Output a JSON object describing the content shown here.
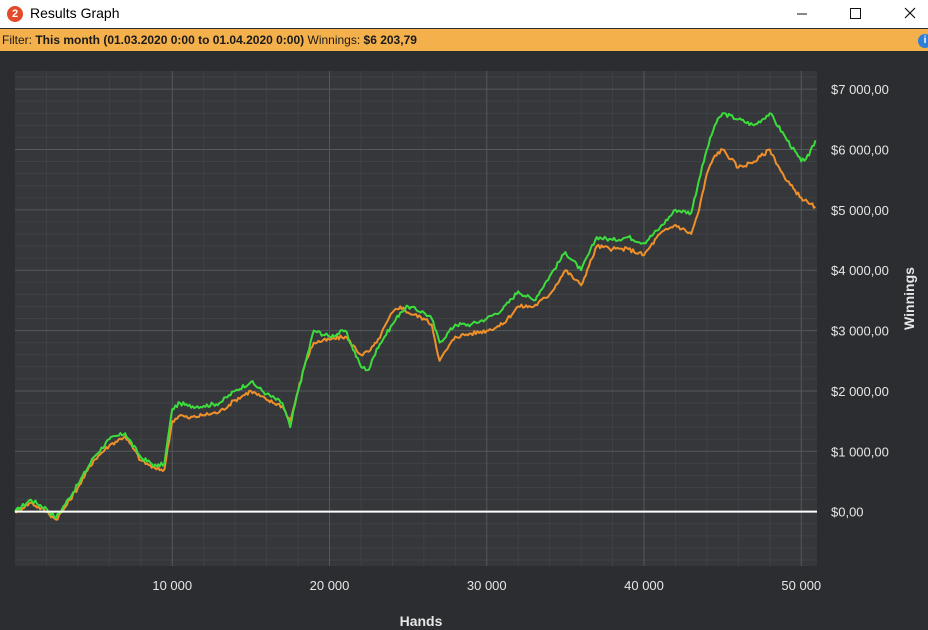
{
  "window": {
    "icon_text": "2",
    "title": "Results Graph"
  },
  "filter": {
    "prefix": "Filter:",
    "period": "This month (01.03.2020 0:00 to 01.04.2020 0:00)",
    "winnings_label": "Winnings:",
    "winnings_value": "$6 203,79",
    "info_icon": "i"
  },
  "colors": {
    "background": "#2b2d30",
    "plot_background": "#35373a",
    "grid_major": "#55585c",
    "grid_minor": "#3f4245",
    "green_series": "#3ddc3d",
    "orange_series": "#f0902a",
    "zero_line": "#ffffff",
    "filter_bar": "#f3b04b"
  },
  "chart_data": {
    "type": "line",
    "xlabel": "Hands",
    "ylabel": "Winnings",
    "xlim": [
      0,
      51000
    ],
    "ylim": [
      -900,
      7300
    ],
    "x_ticks": [
      10000,
      20000,
      30000,
      40000,
      50000
    ],
    "x_tick_labels": [
      "10 000",
      "20 000",
      "30 000",
      "40 000",
      "50 000"
    ],
    "y_ticks": [
      0,
      1000,
      2000,
      3000,
      4000,
      5000,
      6000,
      7000
    ],
    "y_tick_labels": [
      "$0,00",
      "$1 000,00",
      "$2 000,00",
      "$3 000,00",
      "$4 000,00",
      "$5 000,00",
      "$6 000,00",
      "$7 000,00"
    ],
    "grid": true,
    "zero_line": true,
    "series": [
      {
        "color": "#3ddc3d",
        "x": [
          0,
          1000,
          2000,
          2600,
          3000,
          4000,
          5000,
          6000,
          7000,
          8000,
          9000,
          9500,
          10000,
          10500,
          11000,
          12000,
          13000,
          14000,
          15000,
          16000,
          17000,
          17500,
          18000,
          18500,
          19000,
          20000,
          21000,
          22000,
          22500,
          23000,
          24000,
          24500,
          25000,
          26000,
          26500,
          27000,
          28000,
          29000,
          30000,
          31000,
          32000,
          33000,
          34000,
          35000,
          36000,
          37000,
          38000,
          39000,
          40000,
          41000,
          42000,
          43000,
          43500,
          44000,
          44500,
          45000,
          46000,
          47000,
          48000,
          49000,
          50000,
          50500,
          50900
        ],
        "values": [
          0,
          200,
          50,
          -100,
          50,
          450,
          900,
          1200,
          1300,
          900,
          750,
          800,
          1700,
          1800,
          1750,
          1750,
          1800,
          2000,
          2150,
          1950,
          1800,
          1400,
          2000,
          2500,
          3000,
          2900,
          3000,
          2400,
          2350,
          2700,
          3100,
          3300,
          3400,
          3300,
          3200,
          2800,
          3100,
          3100,
          3200,
          3350,
          3650,
          3500,
          3900,
          4300,
          4000,
          4550,
          4500,
          4550,
          4450,
          4700,
          5000,
          4950,
          5500,
          6000,
          6400,
          6600,
          6500,
          6400,
          6600,
          6200,
          5800,
          5900,
          6150
        ]
      },
      {
        "color": "#f0902a",
        "x": [
          0,
          1000,
          2000,
          2600,
          3000,
          4000,
          5000,
          6000,
          7000,
          8000,
          9000,
          9500,
          10000,
          10500,
          11000,
          12000,
          13000,
          14000,
          15000,
          16000,
          17000,
          17500,
          18000,
          18500,
          19000,
          20000,
          21000,
          22000,
          22500,
          23000,
          24000,
          24500,
          25000,
          26000,
          26500,
          27000,
          28000,
          29000,
          30000,
          31000,
          32000,
          33000,
          34000,
          35000,
          36000,
          37000,
          38000,
          39000,
          40000,
          41000,
          42000,
          43000,
          43500,
          44000,
          44500,
          45000,
          46000,
          47000,
          48000,
          49000,
          50000,
          50500,
          50900
        ],
        "values": [
          0,
          150,
          0,
          -130,
          0,
          400,
          850,
          1100,
          1250,
          850,
          700,
          700,
          1500,
          1600,
          1550,
          1600,
          1650,
          1850,
          2000,
          1850,
          1750,
          1500,
          2000,
          2500,
          2800,
          2850,
          2900,
          2600,
          2650,
          2800,
          3300,
          3400,
          3300,
          3200,
          3100,
          2500,
          2900,
          2950,
          3000,
          3100,
          3400,
          3400,
          3600,
          4000,
          3750,
          4400,
          4350,
          4350,
          4250,
          4600,
          4750,
          4600,
          5000,
          5600,
          5900,
          6000,
          5700,
          5800,
          6000,
          5500,
          5200,
          5100,
          5050
        ]
      }
    ]
  }
}
